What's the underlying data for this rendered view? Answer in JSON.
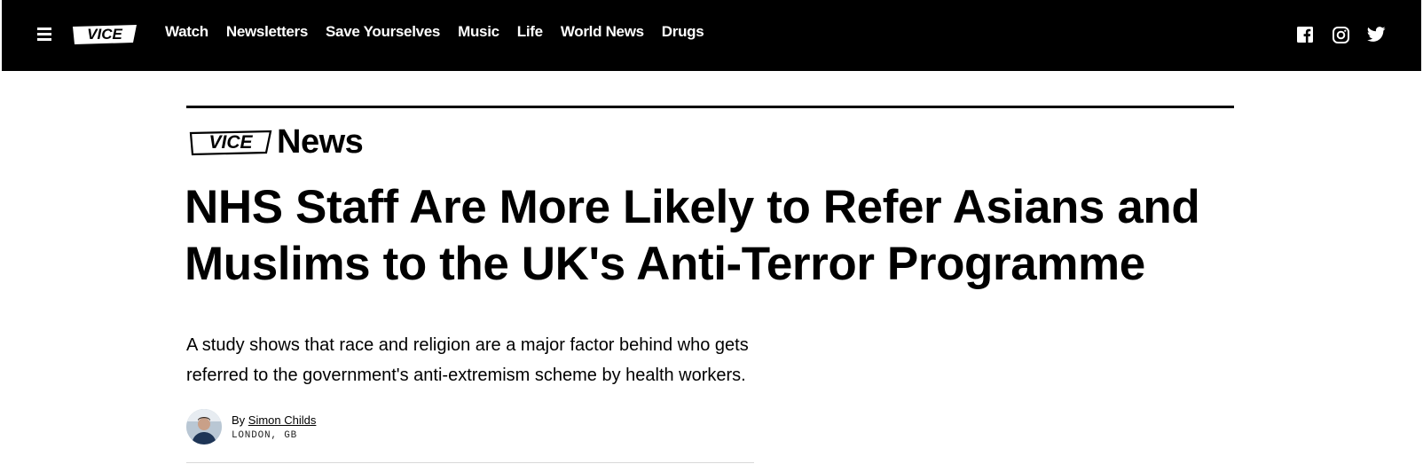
{
  "topbar": {
    "logo_text": "VICE",
    "nav": [
      "Watch",
      "Newsletters",
      "Save Yourselves",
      "Music",
      "Life",
      "World News",
      "Drugs"
    ],
    "social": [
      "facebook-icon",
      "instagram-icon",
      "twitter-icon"
    ]
  },
  "section": {
    "brand": "VICE",
    "label": "News"
  },
  "article": {
    "headline": "NHS Staff Are More Likely to Refer Asians and Muslims to the UK's Anti-Terror Programme",
    "dek": "A study shows that race and religion are a major factor behind who gets referred to the government's anti-extremism scheme by health workers.",
    "byline_prefix": "By ",
    "author": "Simon Childs",
    "location": "LONDON, GB"
  },
  "colors": {
    "topbar": "#000000",
    "text": "#000000",
    "background": "#ffffff"
  }
}
